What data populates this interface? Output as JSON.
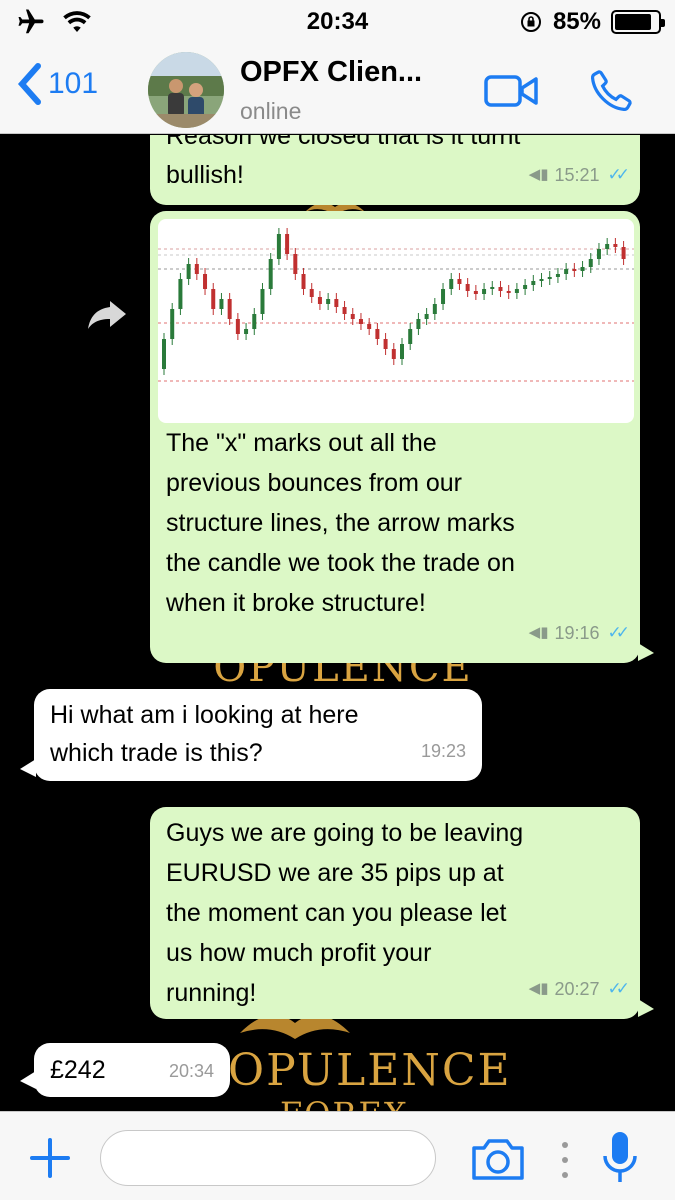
{
  "status": {
    "time": "20:34",
    "battery": "85%",
    "battery_level": 0.85
  },
  "header": {
    "back_count": "101",
    "title": "OPFX Clien...",
    "subtitle": "online"
  },
  "wallpaper": {
    "brand_top": "OPULENCE",
    "brand_bottom": "OPULENCE",
    "brand_sub": "FOREX"
  },
  "messages": [
    {
      "dir": "out",
      "lines": [
        "Reason we closed that is it turnt",
        "bullish!"
      ],
      "time": "15:21"
    },
    {
      "dir": "out",
      "has_image": true,
      "lines": [
        "The \"x\" marks out all the",
        "previous bounces from our",
        "structure lines, the arrow marks",
        "the candle we took the trade on",
        "when it broke structure!"
      ],
      "time": "19:16"
    },
    {
      "dir": "in",
      "lines": [
        "Hi what am i looking at here",
        "which trade is this?"
      ],
      "time": "19:23"
    },
    {
      "dir": "out",
      "lines": [
        "Guys we are going to be leaving",
        "EURUSD we are 35 pips up at",
        "the moment can you please let",
        "us how much profit your",
        "running!"
      ],
      "time": "20:27"
    },
    {
      "dir": "in",
      "lines": [
        "£242"
      ],
      "time": "20:34"
    }
  ],
  "colors": {
    "accent": "#1d7cf2",
    "outgoing": "#dcf8c6",
    "incoming": "#ffffff",
    "read_ticks": "#4fb6ec"
  }
}
